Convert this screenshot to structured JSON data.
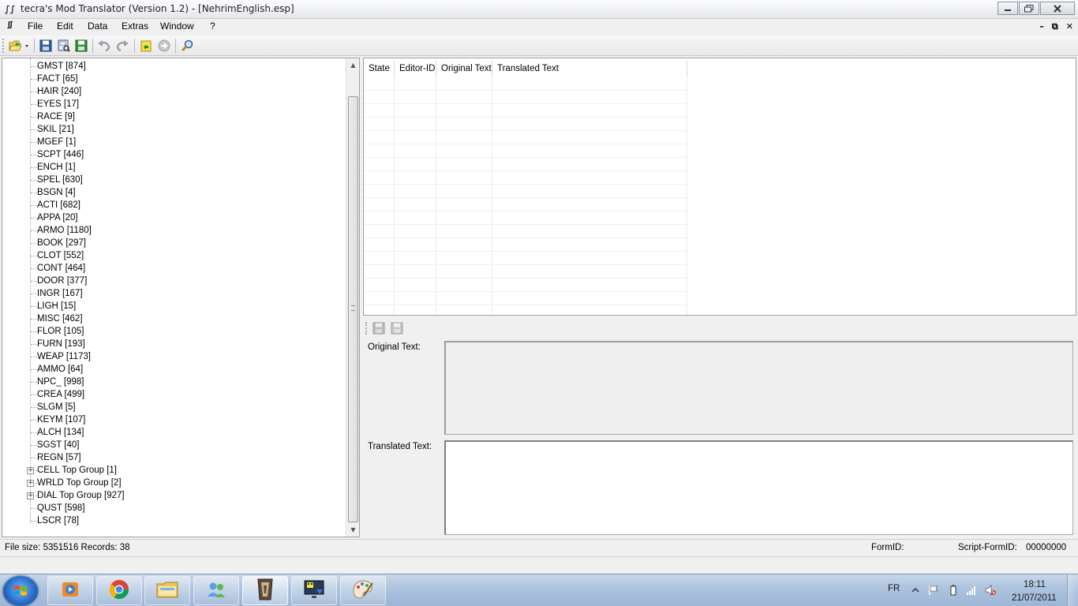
{
  "window": {
    "title": "tecra's Mod Translator (Version 1.2) - [NehrimEnglish.esp]",
    "app_icon": "∫∫",
    "minimize_icon": "minimize-icon",
    "restore_icon": "restore-icon",
    "close_icon": "close-icon"
  },
  "menu": {
    "doc_icon": "∫∫",
    "items": [
      "File",
      "Edit",
      "Data",
      "Extras",
      "Window",
      "?"
    ],
    "mdi_minimize": "–",
    "mdi_restore": "⧉",
    "mdi_close": "✕"
  },
  "toolbar": {
    "buttons": [
      "open-icon",
      "save-icon",
      "save-as-icon",
      "save-all-icon",
      "undo-icon",
      "redo-icon",
      "import-icon",
      "forward-icon",
      "search-icon"
    ]
  },
  "tree": {
    "items": [
      {
        "label": "GMST [874]",
        "expandable": false
      },
      {
        "label": "FACT [65]",
        "expandable": false
      },
      {
        "label": "HAIR [240]",
        "expandable": false
      },
      {
        "label": "EYES [17]",
        "expandable": false
      },
      {
        "label": "RACE [9]",
        "expandable": false
      },
      {
        "label": "SKIL [21]",
        "expandable": false
      },
      {
        "label": "MGEF [1]",
        "expandable": false
      },
      {
        "label": "SCPT [446]",
        "expandable": false
      },
      {
        "label": "ENCH [1]",
        "expandable": false
      },
      {
        "label": "SPEL [630]",
        "expandable": false
      },
      {
        "label": "BSGN [4]",
        "expandable": false
      },
      {
        "label": "ACTI [682]",
        "expandable": false
      },
      {
        "label": "APPA [20]",
        "expandable": false
      },
      {
        "label": "ARMO [1180]",
        "expandable": false
      },
      {
        "label": "BOOK [297]",
        "expandable": false
      },
      {
        "label": "CLOT [552]",
        "expandable": false
      },
      {
        "label": "CONT [464]",
        "expandable": false
      },
      {
        "label": "DOOR [377]",
        "expandable": false
      },
      {
        "label": "INGR [167]",
        "expandable": false
      },
      {
        "label": "LIGH [15]",
        "expandable": false
      },
      {
        "label": "MISC [462]",
        "expandable": false
      },
      {
        "label": "FLOR [105]",
        "expandable": false
      },
      {
        "label": "FURN [193]",
        "expandable": false
      },
      {
        "label": "WEAP [1173]",
        "expandable": false
      },
      {
        "label": "AMMO [64]",
        "expandable": false
      },
      {
        "label": "NPC_ [998]",
        "expandable": false
      },
      {
        "label": "CREA [499]",
        "expandable": false
      },
      {
        "label": "SLGM [5]",
        "expandable": false
      },
      {
        "label": "KEYM [107]",
        "expandable": false
      },
      {
        "label": "ALCH [134]",
        "expandable": false
      },
      {
        "label": "SGST [40]",
        "expandable": false
      },
      {
        "label": "REGN [57]",
        "expandable": false
      },
      {
        "label": "CELL Top Group [1]",
        "expandable": true
      },
      {
        "label": "WRLD Top Group [2]",
        "expandable": true
      },
      {
        "label": "DIAL Top Group [927]",
        "expandable": true
      },
      {
        "label": "QUST [598]",
        "expandable": false
      },
      {
        "label": "LSCR [78]",
        "expandable": false
      }
    ],
    "expander_glyph": "+"
  },
  "grid": {
    "columns": [
      "State",
      "Editor-ID",
      "Original Text",
      "Translated Text"
    ]
  },
  "detail": {
    "toolbar_buttons": [
      "save-disabled-icon",
      "save-all-disabled-icon"
    ],
    "original_label": "Original Text:",
    "translated_label": "Translated Text:"
  },
  "status": {
    "file_info": "File size: 5351516 Records: 38",
    "formid_label": "FormID:",
    "script_formid_label": "Script-FormID:",
    "script_formid_value": "00000000"
  },
  "taskbar": {
    "apps": [
      "media-player-icon",
      "chrome-icon",
      "explorer-icon",
      "people-icon",
      "oblivion-icon",
      "monitor-icon",
      "paint-icon"
    ],
    "active_index": 4,
    "language": "FR",
    "time": "18:11",
    "date": "21/07/2011",
    "tray_icons": [
      "show-hidden-icons-icon",
      "action-center-flag-icon",
      "battery-icon",
      "network-signal-icon",
      "volume-muted-icon"
    ]
  }
}
